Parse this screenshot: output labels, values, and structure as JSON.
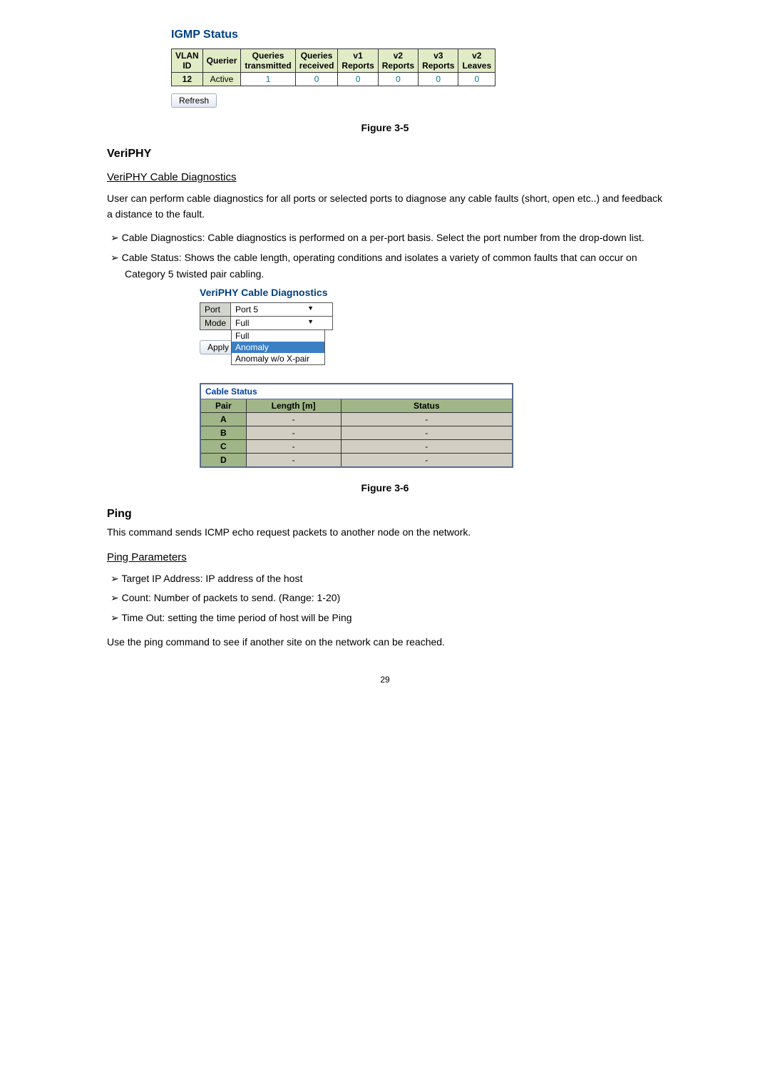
{
  "igmp": {
    "title": "IGMP Status",
    "headers": [
      "VLAN ID",
      "Querier",
      "Queries transmitted",
      "Queries received",
      "v1 Reports",
      "v2 Reports",
      "v3 Reports",
      "v2 Leaves"
    ],
    "row": [
      "12",
      "Active",
      "1",
      "0",
      "0",
      "0",
      "0",
      "0"
    ],
    "refresh": "Refresh"
  },
  "fig35": "Figure 3-5",
  "veriphy": {
    "heading": "VeriPHY",
    "sub": "VeriPHY Cable Diagnostics",
    "para": "User can perform cable diagnostics for all ports or selected ports to diagnose any cable faults (short, open etc..) and feedback a distance to the fault.",
    "bullets": [
      "Cable Diagnostics: Cable diagnostics is performed on a per-port basis. Select the port number from the drop-down list.",
      "Cable Status: Shows the cable length, operating conditions and isolates a variety of common faults that can occur on Category 5 twisted pair cabling."
    ],
    "form_title": "VeriPHY Cable Diagnostics",
    "port_label": "Port",
    "port_value": "Port 5",
    "mode_label": "Mode",
    "mode_value": "Full",
    "options": [
      "Full",
      "Anomaly",
      "Anomaly w/o X-pair"
    ],
    "apply": "Apply"
  },
  "status": {
    "title": "Cable Status",
    "headers": [
      "Pair",
      "Length [m]",
      "Status"
    ],
    "rows": [
      [
        "A",
        "-",
        "-"
      ],
      [
        "B",
        "-",
        "-"
      ],
      [
        "C",
        "-",
        "-"
      ],
      [
        "D",
        "-",
        "-"
      ]
    ]
  },
  "fig36": "Figure 3-6",
  "ping": {
    "heading": "Ping",
    "para": "This command sends ICMP echo request packets to another node on the network.",
    "sub": "Ping Parameters",
    "bullets": [
      "Target IP Address: IP address of the host",
      "Count: Number of packets to send. (Range: 1-20)",
      "Time Out: setting the time period of host will be Ping"
    ],
    "closing": "Use the ping command to see if another site on the network can be reached."
  },
  "page": "29"
}
